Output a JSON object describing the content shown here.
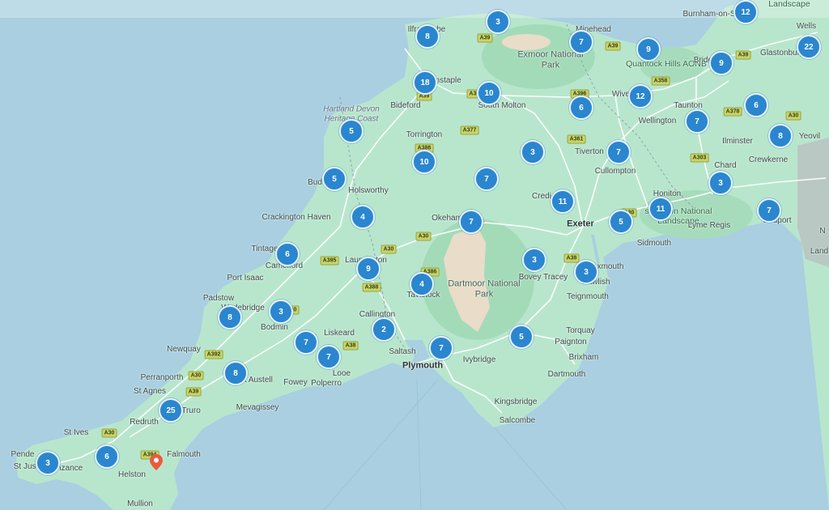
{
  "map": {
    "colors": {
      "sea": "#a9cfe1",
      "land": "#b8e6cc",
      "road": "#ffffff",
      "cluster": "#2a86cf",
      "pin": "#ea5a3d"
    },
    "places": [
      {
        "id": "ilfracombe",
        "text": "Ilfracombe",
        "cls": ""
      },
      {
        "id": "minehead",
        "text": "Minehead",
        "cls": ""
      },
      {
        "id": "burnham",
        "text": "Burnham-on-S",
        "cls": ""
      },
      {
        "id": "landscape-ne",
        "text": "Landscape",
        "cls": "region"
      },
      {
        "id": "wells",
        "text": "Wells",
        "cls": ""
      },
      {
        "id": "glastonbury",
        "text": "Glastonbury",
        "cls": ""
      },
      {
        "id": "exmoor",
        "text": "Exmoor National Park",
        "cls": "park"
      },
      {
        "id": "quantock",
        "text": "Quantock Hills AONB",
        "cls": "region"
      },
      {
        "id": "bridgwater",
        "text": "Bridgw",
        "cls": ""
      },
      {
        "id": "barnstaple",
        "text": "rnstaple",
        "cls": ""
      },
      {
        "id": "south-molton",
        "text": "South Molton",
        "cls": ""
      },
      {
        "id": "wiveliscombe",
        "text": "Wivelisco",
        "cls": ""
      },
      {
        "id": "taunton",
        "text": "Taunton",
        "cls": ""
      },
      {
        "id": "hartland",
        "text": "Hartland Devon Heritage Coast",
        "cls": "heritage"
      },
      {
        "id": "bideford",
        "text": "Bideford",
        "cls": ""
      },
      {
        "id": "wellington",
        "text": "Wellington",
        "cls": ""
      },
      {
        "id": "ilminster",
        "text": "Ilminster",
        "cls": ""
      },
      {
        "id": "yeovil",
        "text": "Yeovil",
        "cls": ""
      },
      {
        "id": "torrington",
        "text": "Torrington",
        "cls": ""
      },
      {
        "id": "tiverton",
        "text": "Tiverton",
        "cls": ""
      },
      {
        "id": "crewkerne",
        "text": "Crewkerne",
        "cls": ""
      },
      {
        "id": "cullompton",
        "text": "Cullompton",
        "cls": ""
      },
      {
        "id": "chard",
        "text": "Chard",
        "cls": ""
      },
      {
        "id": "bude",
        "text": "Bud",
        "cls": ""
      },
      {
        "id": "holsworthy",
        "text": "Holsworthy",
        "cls": ""
      },
      {
        "id": "crediton",
        "text": "Credi",
        "cls": ""
      },
      {
        "id": "honiton",
        "text": "Honiton",
        "cls": ""
      },
      {
        "id": "east-devon",
        "text": "st Devon National Landscape",
        "cls": "region"
      },
      {
        "id": "crackington",
        "text": "Crackington Haven",
        "cls": ""
      },
      {
        "id": "okehampton",
        "text": "Okeham",
        "cls": ""
      },
      {
        "id": "exeter",
        "text": "Exeter",
        "cls": "city"
      },
      {
        "id": "lyme",
        "text": "Lyme Regis",
        "cls": ""
      },
      {
        "id": "bridport",
        "text": "Bridport",
        "cls": ""
      },
      {
        "id": "tintagel",
        "text": "Tintage",
        "cls": ""
      },
      {
        "id": "sidmouth",
        "text": "Sidmouth",
        "cls": ""
      },
      {
        "id": "camelford",
        "text": "Camelford",
        "cls": ""
      },
      {
        "id": "launceston",
        "text": "Launceston",
        "cls": ""
      },
      {
        "id": "exmouth",
        "text": "xmouth",
        "cls": ""
      },
      {
        "id": "port-isaac",
        "text": "Port Isaac",
        "cls": ""
      },
      {
        "id": "dartmoor",
        "text": "Dartmoor National Park",
        "cls": "park"
      },
      {
        "id": "bovey",
        "text": "Bovey Tracey",
        "cls": ""
      },
      {
        "id": "dawlish",
        "text": "Dawlish",
        "cls": ""
      },
      {
        "id": "padstow",
        "text": "Padstow",
        "cls": ""
      },
      {
        "id": "tavistock",
        "text": "Tavistock",
        "cls": ""
      },
      {
        "id": "teignmouth",
        "text": "Teignmouth",
        "cls": ""
      },
      {
        "id": "wadebridge",
        "text": "Wadebridge",
        "cls": ""
      },
      {
        "id": "callington",
        "text": "Callington",
        "cls": ""
      },
      {
        "id": "bodmin",
        "text": "Bodmin",
        "cls": ""
      },
      {
        "id": "liskeard",
        "text": "Liskeard",
        "cls": ""
      },
      {
        "id": "torquay",
        "text": "Torquay",
        "cls": ""
      },
      {
        "id": "paignton",
        "text": "Paignton",
        "cls": ""
      },
      {
        "id": "newquay",
        "text": "Newquay",
        "cls": ""
      },
      {
        "id": "saltash",
        "text": "Saltash",
        "cls": ""
      },
      {
        "id": "plymouth",
        "text": "Plymouth",
        "cls": "city"
      },
      {
        "id": "brixham",
        "text": "Brixham",
        "cls": ""
      },
      {
        "id": "ivybridge",
        "text": "Ivybridge",
        "cls": ""
      },
      {
        "id": "looe",
        "text": "Looe",
        "cls": ""
      },
      {
        "id": "perranporth",
        "text": "Perranporth",
        "cls": ""
      },
      {
        "id": "st-austell",
        "text": "St Austell",
        "cls": ""
      },
      {
        "id": "dartmouth",
        "text": "Dartmouth",
        "cls": ""
      },
      {
        "id": "st-agnes",
        "text": "St Agnes",
        "cls": ""
      },
      {
        "id": "fowey",
        "text": "Fowey",
        "cls": ""
      },
      {
        "id": "polperro",
        "text": "Polperro",
        "cls": ""
      },
      {
        "id": "truro",
        "text": "Truro",
        "cls": ""
      },
      {
        "id": "kingsbridge",
        "text": "Kingsbridge",
        "cls": ""
      },
      {
        "id": "mevagissey",
        "text": "Mevagissey",
        "cls": ""
      },
      {
        "id": "redruth",
        "text": "Redruth",
        "cls": ""
      },
      {
        "id": "salcombe",
        "text": "Salcombe",
        "cls": ""
      },
      {
        "id": "st-ives",
        "text": "St Ives",
        "cls": ""
      },
      {
        "id": "falmouth",
        "text": "Falmouth",
        "cls": ""
      },
      {
        "id": "pendeen",
        "text": "Pende",
        "cls": ""
      },
      {
        "id": "st-just",
        "text": "St Just",
        "cls": ""
      },
      {
        "id": "penzance",
        "text": "Penzance",
        "cls": ""
      },
      {
        "id": "helston",
        "text": "Helston",
        "cls": ""
      },
      {
        "id": "mullion",
        "text": "Mullion",
        "cls": ""
      },
      {
        "id": "landscape-e",
        "text": "Land",
        "cls": ""
      },
      {
        "id": "dorset-n",
        "text": "N",
        "cls": ""
      }
    ],
    "roads": [
      {
        "id": "a39-n",
        "label": "A39"
      },
      {
        "id": "a39-mh",
        "label": "A39"
      },
      {
        "id": "a39-gl",
        "label": "A39"
      },
      {
        "id": "a396-n",
        "label": "A396"
      },
      {
        "id": "a358",
        "label": "A358"
      },
      {
        "id": "a361",
        "label": "A361"
      },
      {
        "id": "a39-b",
        "label": "A39"
      },
      {
        "id": "a3-sm",
        "label": "A3"
      },
      {
        "id": "a377",
        "label": "A377"
      },
      {
        "id": "a386",
        "label": "A386"
      },
      {
        "id": "a378",
        "label": "A378"
      },
      {
        "id": "a303",
        "label": "A303"
      },
      {
        "id": "a30-y",
        "label": "A30"
      },
      {
        "id": "a30-ok",
        "label": "A30"
      },
      {
        "id": "a30-la",
        "label": "A30"
      },
      {
        "id": "a395",
        "label": "A395"
      },
      {
        "id": "a386-t",
        "label": "A386"
      },
      {
        "id": "a388",
        "label": "A388"
      },
      {
        "id": "a38-e",
        "label": "A38"
      },
      {
        "id": "a30-h",
        "label": "A30"
      },
      {
        "id": "a390",
        "label": "A390"
      },
      {
        "id": "a38-l",
        "label": "A38"
      },
      {
        "id": "a392",
        "label": "A392"
      },
      {
        "id": "a30-np",
        "label": "A30"
      },
      {
        "id": "a39-t",
        "label": "A39"
      },
      {
        "id": "a30-r",
        "label": "A30"
      },
      {
        "id": "a394",
        "label": "A394"
      },
      {
        "id": "a30-b",
        "label": "A30"
      }
    ],
    "clusters": [
      {
        "id": "c01",
        "count": "3"
      },
      {
        "id": "c02",
        "count": "12"
      },
      {
        "id": "c03",
        "count": "8"
      },
      {
        "id": "c04",
        "count": "7"
      },
      {
        "id": "c05",
        "count": "9"
      },
      {
        "id": "c06",
        "count": "22"
      },
      {
        "id": "c07",
        "count": "9"
      },
      {
        "id": "c08",
        "count": "18"
      },
      {
        "id": "c09",
        "count": "10"
      },
      {
        "id": "c10",
        "count": "12"
      },
      {
        "id": "c11",
        "count": "6"
      },
      {
        "id": "c12",
        "count": "6"
      },
      {
        "id": "c13",
        "count": "5"
      },
      {
        "id": "c14",
        "count": "7"
      },
      {
        "id": "c15",
        "count": "8"
      },
      {
        "id": "c16",
        "count": "3"
      },
      {
        "id": "c17",
        "count": "7"
      },
      {
        "id": "c18",
        "count": "10"
      },
      {
        "id": "c19",
        "count": "5"
      },
      {
        "id": "c20",
        "count": "7"
      },
      {
        "id": "c21",
        "count": "3"
      },
      {
        "id": "c22",
        "count": "11"
      },
      {
        "id": "c23",
        "count": "11"
      },
      {
        "id": "c24",
        "count": "7"
      },
      {
        "id": "c25",
        "count": "4"
      },
      {
        "id": "c26",
        "count": "7"
      },
      {
        "id": "c27",
        "count": "5"
      },
      {
        "id": "c28",
        "count": "6"
      },
      {
        "id": "c29",
        "count": "9"
      },
      {
        "id": "c30",
        "count": "3"
      },
      {
        "id": "c31",
        "count": "3"
      },
      {
        "id": "c32",
        "count": "4"
      },
      {
        "id": "c33",
        "count": "8"
      },
      {
        "id": "c34",
        "count": "3"
      },
      {
        "id": "c35",
        "count": "7"
      },
      {
        "id": "c36",
        "count": "2"
      },
      {
        "id": "c37",
        "count": "5"
      },
      {
        "id": "c38",
        "count": "7"
      },
      {
        "id": "c39",
        "count": "7"
      },
      {
        "id": "c40",
        "count": "8"
      },
      {
        "id": "c41",
        "count": "25"
      },
      {
        "id": "c42",
        "count": "6"
      },
      {
        "id": "c43",
        "count": "3"
      }
    ],
    "pin": {
      "label": "location-pin"
    }
  }
}
